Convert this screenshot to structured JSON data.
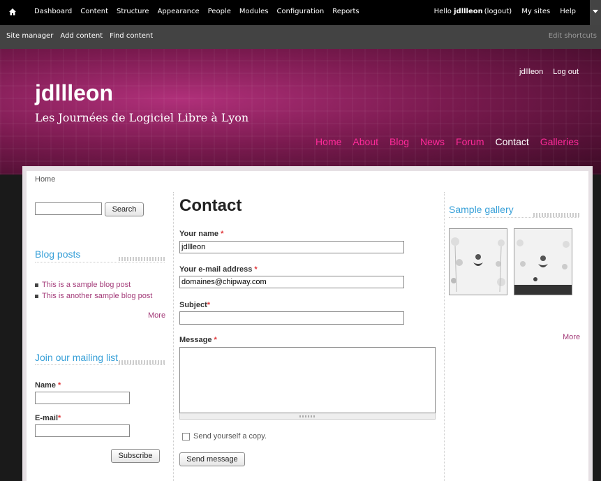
{
  "toolbar": {
    "menu": [
      "Dashboard",
      "Content",
      "Structure",
      "Appearance",
      "People",
      "Modules",
      "Configuration",
      "Reports"
    ],
    "hello_prefix": "Hello",
    "username": "jdllleon",
    "logout": "(logout)",
    "my_sites": "My sites",
    "help": "Help",
    "shortcuts": [
      "Site manager",
      "Add content",
      "Find content"
    ],
    "edit_shortcuts": "Edit shortcuts"
  },
  "header": {
    "site_name": "jdllleon",
    "slogan": "Les Journées de Logiciel Libre à Lyon",
    "user_link": "jdllleon",
    "logout_link": "Log out",
    "nav": [
      "Home",
      "About",
      "Blog",
      "News",
      "Forum",
      "Contact",
      "Galleries"
    ],
    "nav_active": "Contact"
  },
  "breadcrumb": "Home",
  "sidebar_left": {
    "search_button": "Search",
    "search_value": "",
    "blog_title": "Blog posts",
    "blog_posts": [
      "This is a sample blog post",
      "This is another sample blog post"
    ],
    "blog_more": "More",
    "mailing_title": "Join our mailing list",
    "name_label": "Name",
    "email_label": "E-mail",
    "required_mark": "*",
    "subscribe_button": "Subscribe"
  },
  "contact": {
    "title": "Contact",
    "name_label": "Your name",
    "name_value": "jdllleon",
    "email_label": "Your e-mail address",
    "email_value": "domaines@chipway.com",
    "subject_label": "Subject",
    "subject_value": "",
    "message_label": "Message",
    "message_value": "",
    "copy_label": "Send yourself a copy.",
    "submit_button": "Send message"
  },
  "sidebar_right": {
    "gallery_title": "Sample gallery",
    "gallery_more": "More"
  },
  "colors": {
    "accent_blue": "#38a0d8",
    "link_purple": "#a33a78",
    "nav_pink": "#ff2a9a",
    "required_red": "#e0383b"
  }
}
